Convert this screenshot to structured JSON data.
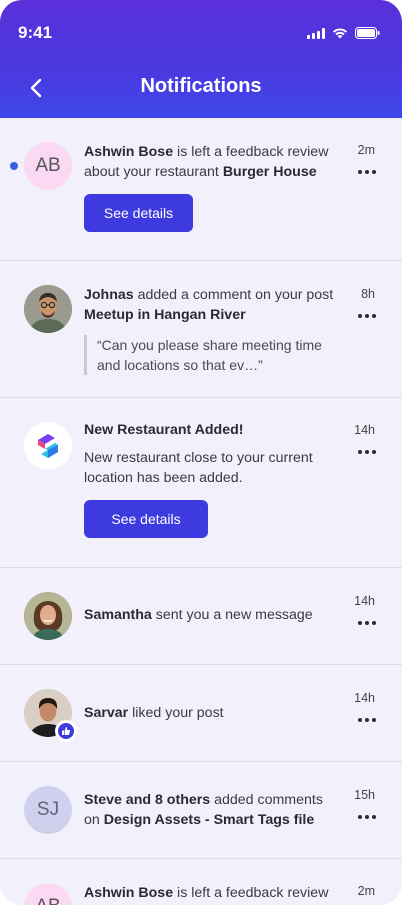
{
  "status_bar": {
    "time": "9:41"
  },
  "header": {
    "title": "Notifications"
  },
  "notifications": [
    {
      "initials": "AB",
      "actor": "Ashwin Bose",
      "text": " is left a feedback review about your restaurant ",
      "object": "Burger House",
      "time": "2m",
      "button": "See details",
      "unread": true
    },
    {
      "actor": "Johnas",
      "text": " added a comment on your post ",
      "object": "Meetup in Hangan River",
      "quote": "“Can you please share meeting time and locations so that ev…”",
      "time": "8h"
    },
    {
      "title": "New Restaurant Added!",
      "body": "New restaurant close to your current location has been added.",
      "time": "14h",
      "button": "See details"
    },
    {
      "actor": "Samantha",
      "text": " sent you a new message",
      "time": "14h"
    },
    {
      "actor": "Sarvar",
      "text": " liked your post",
      "time": "14h"
    },
    {
      "initials": "SJ",
      "actor": "Steve and 8 others",
      "text": " added comments on ",
      "object": "Design Assets - Smart Tags file",
      "time": "15h"
    },
    {
      "initials": "AB",
      "actor": "Ashwin Bose",
      "text": " is left a feedback review",
      "time": "2m"
    }
  ],
  "colors": {
    "header_top": "#5a2fd9",
    "header_bottom": "#3f47e8",
    "accent": "#3d3be0",
    "background": "#f1f0fb",
    "unread_dot": "#3b5ee6"
  }
}
